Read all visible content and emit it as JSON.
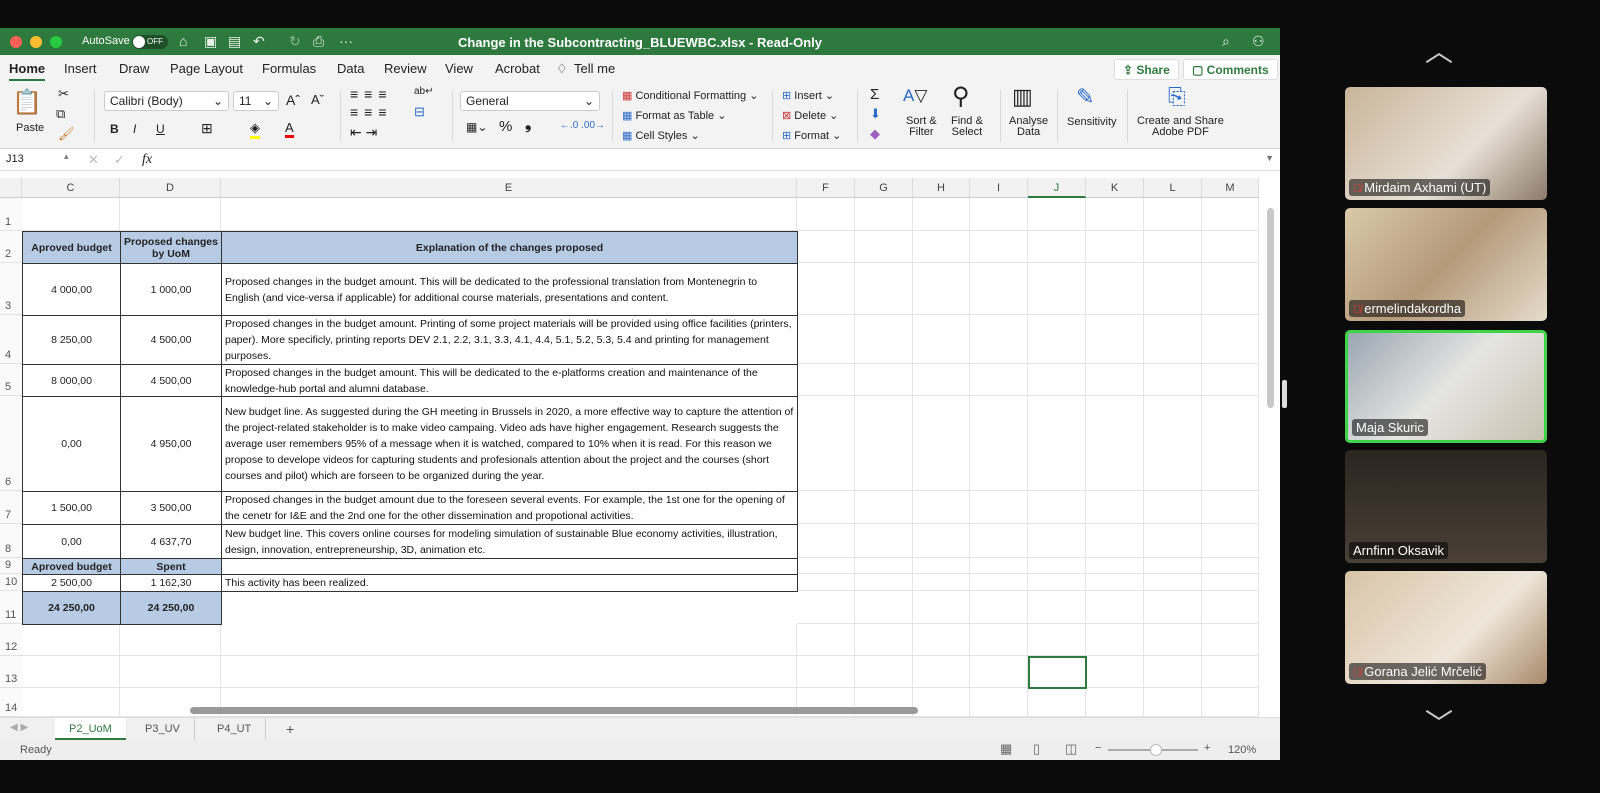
{
  "titlebar": {
    "autosave": "AutoSave",
    "autosave_state": "OFF",
    "title": "Change in the Subcontracting_BLUEWBC.xlsx - Read-Only"
  },
  "ribbon_tabs": [
    "Home",
    "Insert",
    "Draw",
    "Page Layout",
    "Formulas",
    "Data",
    "Review",
    "View",
    "Acrobat",
    "Tell me"
  ],
  "header_buttons": {
    "share": "Share",
    "comments": "Comments"
  },
  "ribbon": {
    "paste": "Paste",
    "font": "Calibri (Body)",
    "size": "11",
    "number_format": "General",
    "conditional": "Conditional Formatting",
    "format_table": "Format as Table",
    "cell_styles": "Cell Styles",
    "insert": "Insert",
    "delete": "Delete",
    "format": "Format",
    "sort1": "Sort &",
    "sort2": "Filter",
    "find1": "Find &",
    "find2": "Select",
    "analyse1": "Analyse",
    "analyse2": "Data",
    "sensitivity": "Sensitivity",
    "pdf1": "Create and Share",
    "pdf2": "Adobe PDF",
    "bold": "B",
    "italic": "I",
    "underline": "U"
  },
  "formula_bar": {
    "name_box": "J13",
    "fx": "fx",
    "value": ""
  },
  "columns": [
    "C",
    "D",
    "E",
    "F",
    "G",
    "H",
    "I",
    "J",
    "K",
    "L",
    "M"
  ],
  "rows": [
    "1",
    "2",
    "3",
    "4",
    "5",
    "6",
    "7",
    "8",
    "9",
    "10",
    "11",
    "12",
    "13",
    "14"
  ],
  "table": {
    "header": [
      "Aproved budget",
      "Proposed changes by UoM",
      "Explanation of the changes proposed"
    ],
    "rows": [
      [
        "4 000,00",
        "1 000,00",
        "Proposed changes in the budget amount. This will be dedicated to the professional translation from Montenegrin to English (and vice-versa if applicable) for additional course materials, presentations and content."
      ],
      [
        "8 250,00",
        "4 500,00",
        "Proposed changes in the budget amount. Printing of some project materials will be provided using office facilities (printers, paper). More specificly, printing reports DEV 2.1, 2.2, 3.1, 3.3, 4.1, 4.4, 5.1, 5.2, 5.3, 5.4 and printing for management purposes."
      ],
      [
        "8 000,00",
        "4 500,00",
        "Proposed changes in the budget amount. This will be dedicated to the e-platforms creation and maintenance of the knowledge-hub portal and alumni database."
      ],
      [
        "0,00",
        "4 950,00",
        "New budget line. As suggested during the GH meeting in Brussels in 2020, a more effective way to capture the attention of the project-related stakeholder is to make video campaing. Video ads have higher engagement. Research suggests the average user remembers 95% of a message when it is watched, compared to 10% when it is read. For this reason we propose to develope videos for capturing students and profesionals attention about the project  and the courses (short courses and pilot) which are forseen to be organized during the year."
      ],
      [
        "1 500,00",
        "3 500,00",
        "Proposed changes in the budget amount due to the foreseen several events. For example, the 1st one for the opening of the cenetr for I&E and the 2nd one for the other dissemination and propotional activities."
      ],
      [
        "0,00",
        "4 637,70",
        "New budget line. This covers online courses for modeling simulation of sustainable Blue economy activities, illustration, design, innovation, entrepreneurship, 3D, animation etc."
      ]
    ],
    "header2": [
      "Aproved budget",
      "Spent"
    ],
    "row10": [
      "2 500,00",
      "1 162,30",
      "This activity has been realized."
    ],
    "totals": [
      "24 250,00",
      "24 250,00"
    ]
  },
  "sheet_tabs": [
    "P2_UoM",
    "P3_UV",
    "P4_UT",
    "+"
  ],
  "status": {
    "ready": "Ready",
    "zoom": "120%"
  },
  "participants": [
    "Mirdaim Axhami (UT)",
    "ermelindakordha",
    "Maja Skuric",
    "Arnfinn Oksavik",
    "Gorana Jelić Mrčelić"
  ]
}
